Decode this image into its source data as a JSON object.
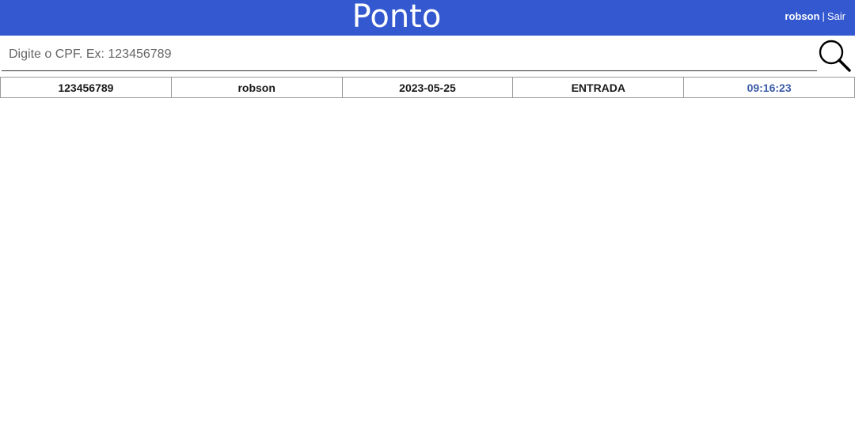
{
  "header": {
    "title": "Ponto",
    "user_name": "robson",
    "separator": "|",
    "logout_label": "Sair"
  },
  "search": {
    "placeholder": "Digite o CPF. Ex: 123456789",
    "value": "",
    "icon": "search-icon"
  },
  "records": [
    {
      "cpf": "123456789",
      "name": "robson",
      "date": "2023-05-25",
      "type": "ENTRADA",
      "time": "09:16:23"
    }
  ],
  "colors": {
    "header_bg": "#3358cf",
    "time_text": "#3a5ba8"
  }
}
